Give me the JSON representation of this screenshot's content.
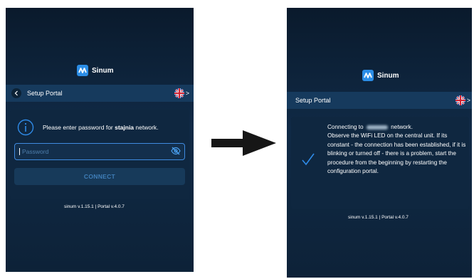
{
  "app": {
    "brand": "Sinum"
  },
  "left_screen": {
    "header": {
      "title": "Setup Portal",
      "lang_arrow": ">"
    },
    "prompt": {
      "prefix": "Please enter password for ",
      "network": "stajnia",
      "suffix": " network."
    },
    "password": {
      "placeholder": "Password",
      "value": ""
    },
    "connect_label": "CONNECT",
    "version": "sinum v.1.15.1 | Portal v.4.0.7"
  },
  "right_screen": {
    "header": {
      "title": "Setup Portal",
      "lang_arrow": ">"
    },
    "message": {
      "line1_prefix": "Connecting to ",
      "line1_suffix": " network.",
      "body": "Observe the WiFi LED on the central unit. If its constant - the connection has been established, if it is blinking or turned off - there is a problem, start the procedure from the beginning by restarting the configuration portal."
    },
    "version": "sinum v.1.15.1 | Portal v.4.0.7"
  },
  "colors": {
    "accent": "#2b8de6",
    "background": "#0d2238",
    "card": "#0f2740"
  },
  "icons": [
    "back-icon",
    "uk-flag-icon",
    "info-icon",
    "eye-off-icon",
    "checkmark-icon",
    "right-arrow-icon"
  ]
}
